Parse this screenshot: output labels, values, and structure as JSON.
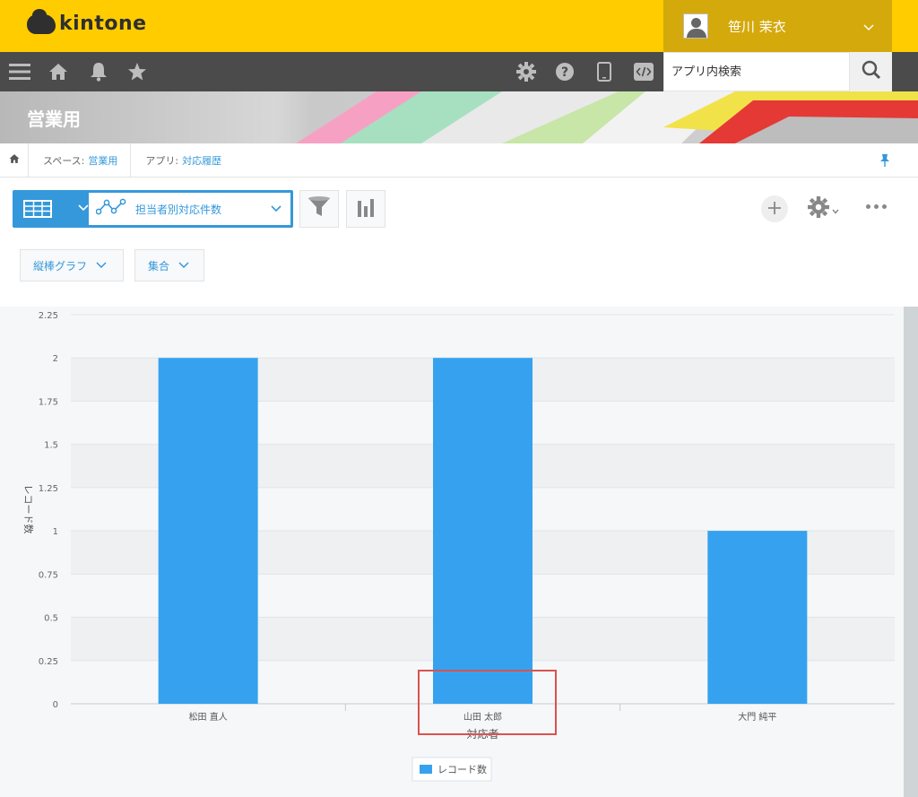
{
  "header": {
    "logo_text": "kintone",
    "user_name": "笹川 茉衣",
    "brand_color": "#ffcc00",
    "icons": [
      "menu-icon",
      "home-icon",
      "bell-icon",
      "star-icon",
      "gear-icon",
      "help-icon",
      "mobile-icon",
      "code-icon"
    ]
  },
  "search": {
    "placeholder": "アプリ内検索"
  },
  "banner": {
    "space_title": "営業用"
  },
  "breadcrumb": {
    "space_prefix": "スペース:",
    "space_name": "営業用",
    "app_prefix": "アプリ:",
    "app_name": "対応履歴"
  },
  "toolbar": {
    "view_name": "担当者別対応件数",
    "chart_type": "縦棒グラフ",
    "aggregation": "集合"
  },
  "chart_data": {
    "type": "bar",
    "categories": [
      "松田 直人",
      "山田 太郎",
      "大門 純平"
    ],
    "series": [
      {
        "name": "レコード数",
        "values": [
          2,
          2,
          1
        ],
        "color": "#36a2ef"
      }
    ],
    "xlabel": "対応者",
    "ylabel": "レコード数",
    "ylim": [
      0,
      2.25
    ],
    "yticks": [
      "0",
      "0.25",
      "0.5",
      "0.75",
      "1",
      "1.25",
      "1.5",
      "1.75",
      "2",
      "2.25"
    ],
    "grid": true,
    "legend": "bottom"
  }
}
